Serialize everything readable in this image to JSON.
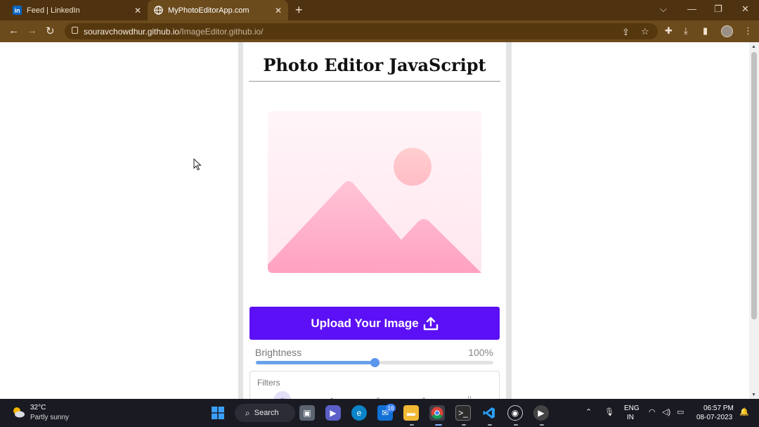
{
  "browser": {
    "tabs": [
      {
        "title": "Feed | LinkedIn",
        "favicon": "linkedin-icon",
        "active": false
      },
      {
        "title": "MyPhotoEditorApp.com",
        "favicon": "globe-icon",
        "active": true
      }
    ],
    "address": {
      "host": "souravchowdhur.github.io",
      "path": "/ImageEditor.github.io/"
    },
    "colors": {
      "tabbar": "#4f3210",
      "toolbar": "#6b4a1c"
    }
  },
  "app": {
    "title": "Photo Editor JavaScript",
    "upload_label": "Upload Your Image",
    "brightness": {
      "label": "Brightness",
      "value_text": "100%",
      "level_fraction": 0.5
    },
    "filters": {
      "label": "Filters",
      "icons": [
        "brightness-filter-icon",
        "contrast-filter-icon",
        "saturation-filter-icon",
        "invert-filter-icon",
        "blur-filter-icon"
      ]
    },
    "colors": {
      "accent": "#5b10f5",
      "slider": "#6aa1ea",
      "placeholder_pink": "#ffa6c6"
    }
  },
  "taskbar": {
    "weather": {
      "temp": "32°C",
      "condition": "Partly sunny"
    },
    "search_label": "Search",
    "mail_badge": "16",
    "language": {
      "line1": "ENG",
      "line2": "IN"
    },
    "clock": {
      "time": "06:57 PM",
      "date": "08-07-2023"
    }
  }
}
